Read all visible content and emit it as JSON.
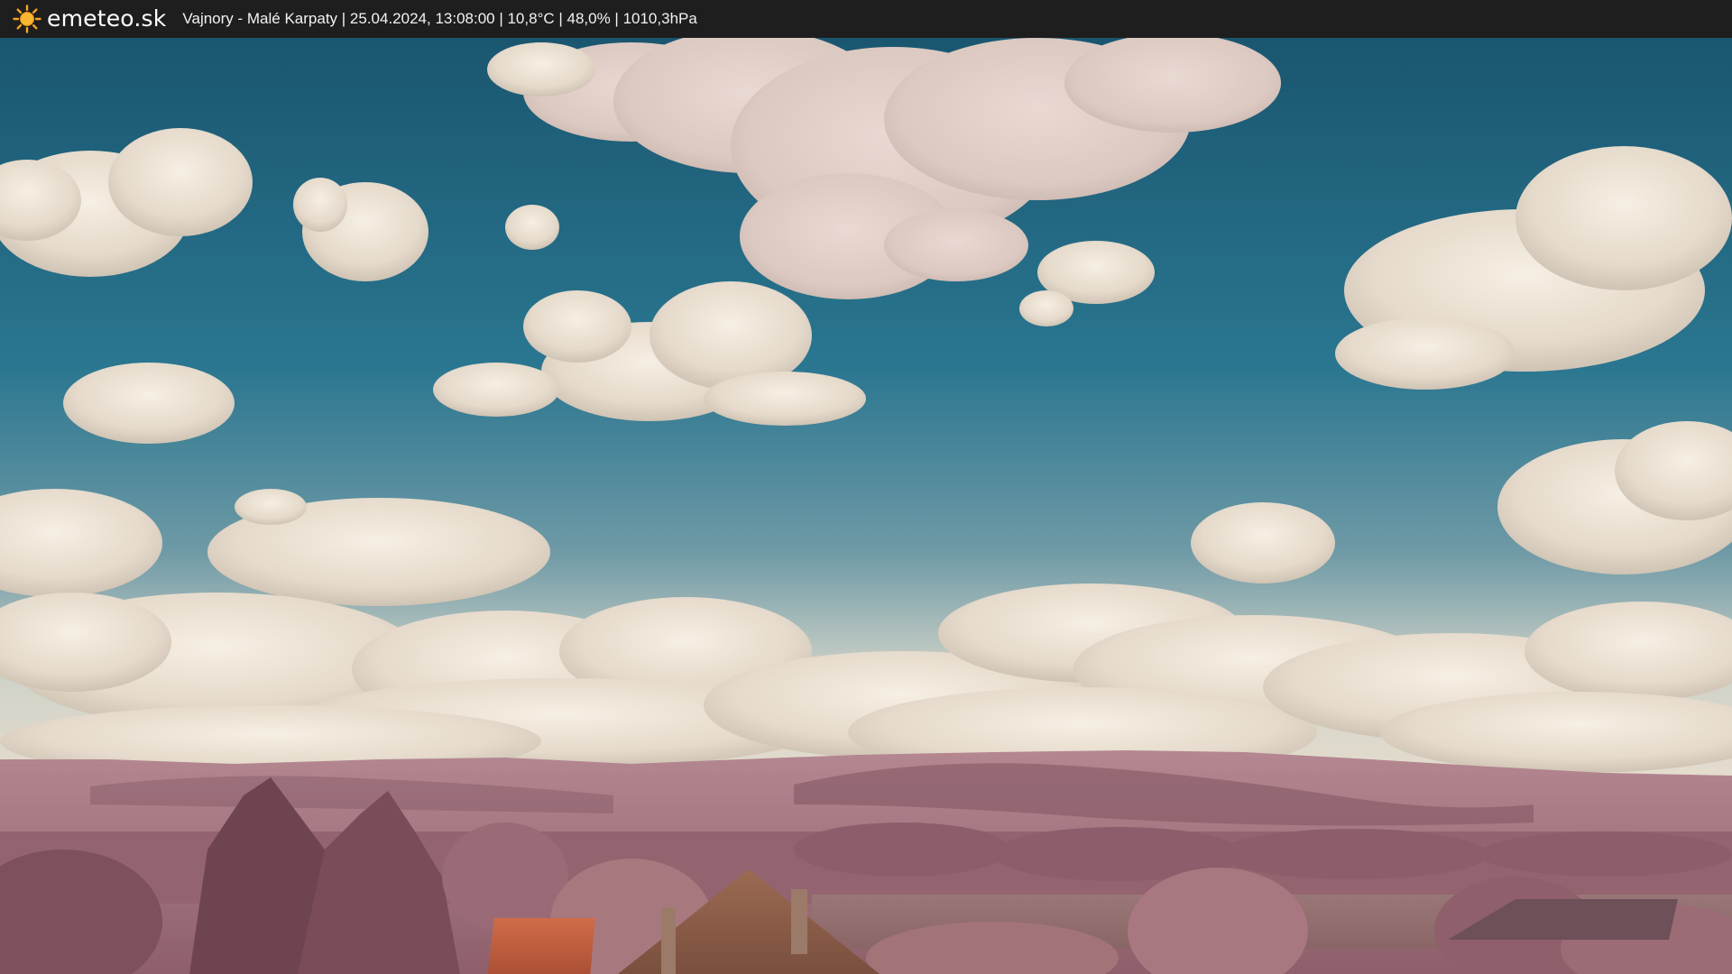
{
  "header": {
    "brand": "emeteo.sk",
    "logo_icon": "sun-icon",
    "caption": "Vajnory - Malé Karpaty | 25.04.2024, 13:08:00 | 10,8°C | 48,0% | 1010,3hPa"
  },
  "colors": {
    "bar": "#1e1e1e",
    "sun": "#f5a623",
    "sky_top": "#1c5a73",
    "sky_mid": "#2b7690",
    "cloud": "#ece3d6",
    "hills": "#a2727e",
    "roof": "#c4613f"
  }
}
